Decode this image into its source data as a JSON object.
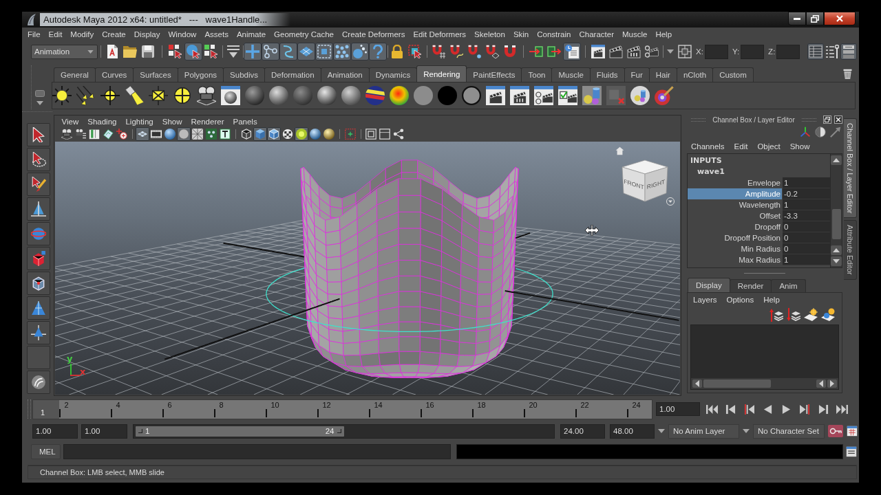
{
  "window": {
    "title": "Autodesk Maya 2012 x64: untitled*   ---   wave1Handle..."
  },
  "menu_bar": [
    "File",
    "Edit",
    "Modify",
    "Create",
    "Display",
    "Window",
    "Assets",
    "Animate",
    "Geometry Cache",
    "Create Deformers",
    "Edit Deformers",
    "Skeleton",
    "Skin",
    "Constrain",
    "Character",
    "Muscle",
    "Help"
  ],
  "status_line": {
    "menu_set": "Animation",
    "tools": [
      {
        "on": false
      },
      {
        "on": false
      },
      {
        "on": false
      },
      {
        "on": false
      },
      {
        "on": true
      },
      {
        "on": false
      },
      {
        "on": false
      },
      {
        "on": true
      },
      {
        "on": true
      },
      {
        "on": true
      },
      {
        "on": true
      },
      {
        "on": true
      },
      {
        "on": true
      },
      {
        "on": true
      },
      {
        "on": true
      },
      {
        "on": false
      },
      {
        "on": false
      },
      {
        "on": false
      },
      {
        "on": false
      },
      {
        "on": false
      },
      {
        "on": false
      },
      {
        "on": false
      },
      {
        "on": false
      },
      {
        "on": false
      },
      {
        "on": true
      },
      {
        "on": false
      },
      {
        "on": false
      },
      {
        "on": false
      },
      {
        "on": false
      },
      {
        "on": false
      },
      {
        "on": false
      }
    ],
    "coordinates": [
      "X:",
      "Y:",
      "Z:"
    ],
    "panel_toggles": [
      {
        "on": true
      },
      {
        "on": false
      },
      {
        "on": true
      }
    ]
  },
  "shelf": {
    "tabs": [
      {
        "label": "General",
        "selected": false
      },
      {
        "label": "Curves",
        "selected": false
      },
      {
        "label": "Surfaces",
        "selected": false
      },
      {
        "label": "Polygons",
        "selected": false
      },
      {
        "label": "Subdivs",
        "selected": false
      },
      {
        "label": "Deformation",
        "selected": false
      },
      {
        "label": "Animation",
        "selected": false
      },
      {
        "label": "Dynamics",
        "selected": false
      },
      {
        "label": "Rendering",
        "selected": true
      },
      {
        "label": "PaintEffects",
        "selected": false
      },
      {
        "label": "Toon",
        "selected": false
      },
      {
        "label": "Muscle",
        "selected": false
      },
      {
        "label": "Fluids",
        "selected": false
      },
      {
        "label": "Fur",
        "selected": false
      },
      {
        "label": "Hair",
        "selected": false
      },
      {
        "label": "nCloth",
        "selected": false
      },
      {
        "label": "Custom",
        "selected": false
      }
    ]
  },
  "viewport": {
    "menu": [
      "View",
      "Shading",
      "Lighting",
      "Show",
      "Renderer",
      "Panels"
    ],
    "toolbar": [
      {
        "on": false
      },
      {
        "on": false
      },
      {
        "on": false
      },
      {
        "on": false
      },
      {
        "on": false
      },
      {
        "on": true
      },
      {
        "on": false
      },
      {
        "on": false
      },
      {
        "on": true
      },
      {
        "on": false
      },
      {
        "on": false
      },
      {
        "on": false
      },
      {
        "on": false
      },
      {
        "on": true
      },
      {
        "on": true
      },
      {
        "on": false
      },
      {
        "on": true
      },
      {
        "on": false
      },
      {
        "on": false
      },
      {
        "on": false
      },
      {
        "on": false
      },
      {
        "on": false
      },
      {
        "on": false
      }
    ],
    "view_cube": [
      "FRONT",
      "RIGHT"
    ],
    "axis_labels": [
      {
        "label": "y",
        "color": "#44cc44"
      },
      {
        "label": "x",
        "color": "#dd3333"
      }
    ]
  },
  "channel_box": {
    "title": "Channel Box / Layer Editor",
    "menu": [
      "Channels",
      "Edit",
      "Object",
      "Show"
    ],
    "section": "INPUTS",
    "node": "wave1",
    "attributes": [
      {
        "label": "Envelope",
        "value": "1",
        "selected": false
      },
      {
        "label": "Amplitude",
        "value": "-0.2",
        "selected": true
      },
      {
        "label": "Wavelength",
        "value": "1",
        "selected": false
      },
      {
        "label": "Offset",
        "value": "-3.3",
        "selected": false
      },
      {
        "label": "Dropoff",
        "value": "0",
        "selected": false
      },
      {
        "label": "Dropoff Position",
        "value": "0",
        "selected": false
      },
      {
        "label": "Min Radius",
        "value": "0",
        "selected": false
      },
      {
        "label": "Max Radius",
        "value": "1",
        "selected": false
      }
    ],
    "layer_editor": {
      "tabs": [
        {
          "label": "Display",
          "selected": true
        },
        {
          "label": "Render",
          "selected": false
        },
        {
          "label": "Anim",
          "selected": false
        }
      ],
      "menu": [
        "Layers",
        "Options",
        "Help"
      ]
    }
  },
  "side_tabs": [
    {
      "label": "Channel Box / Layer Editor",
      "selected": true
    },
    {
      "label": "Attribute Editor",
      "selected": false
    }
  ],
  "timeline": {
    "ticks": [
      "2",
      "4",
      "6",
      "8",
      "10",
      "12",
      "14",
      "16",
      "18",
      "20",
      "22",
      "24"
    ],
    "playhead": {
      "label": "1",
      "level": 0
    },
    "current_time": "1.00"
  },
  "range_slider": {
    "start_time": "1.00",
    "playback_start": "1.00",
    "range": {
      "start_label": "1",
      "end_label": "24",
      "level": 0.5
    },
    "playback_end": "24.00",
    "end_time": "48.00",
    "anim_layer": "No Anim Layer",
    "character_set": "No Character Set",
    "auto_key": {
      "on": true
    }
  },
  "command_line": {
    "language": "MEL"
  },
  "help_line": "Channel Box: LMB select, MMB slide"
}
